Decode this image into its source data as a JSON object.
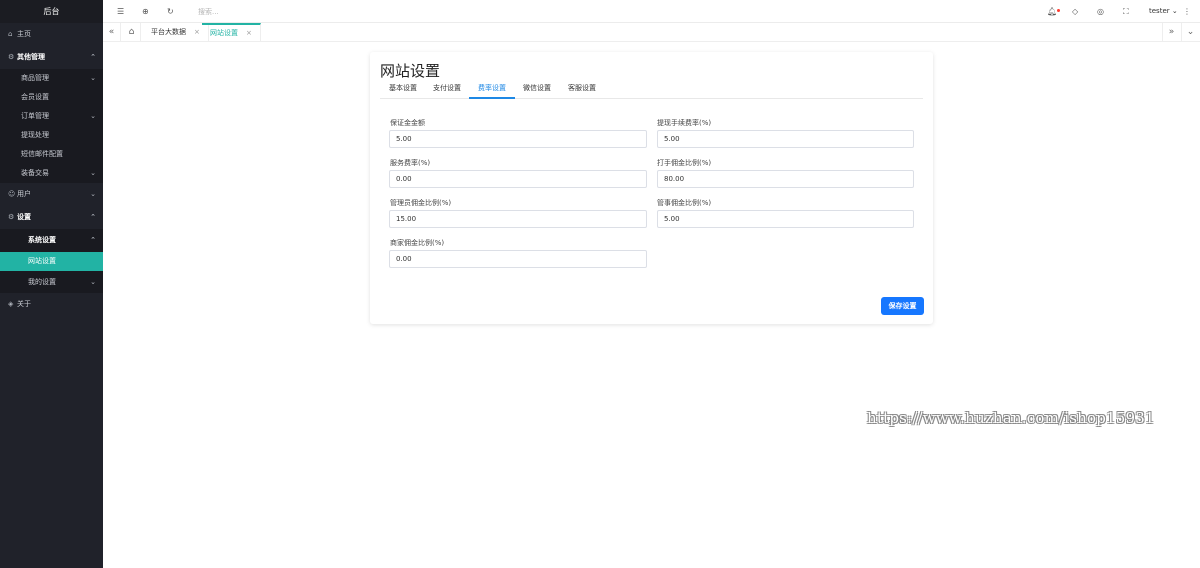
{
  "sidebar": {
    "brand": "后台",
    "home": {
      "label": "主页",
      "icon": "home-icon"
    },
    "other_mgmt": {
      "label": "其他管理",
      "icon": "gear-icon"
    },
    "other_items": [
      {
        "label": "商品管理",
        "has_children": true
      },
      {
        "label": "会员设置",
        "has_children": false
      },
      {
        "label": "订单管理",
        "has_children": true
      },
      {
        "label": "提现处理",
        "has_children": false
      },
      {
        "label": "短信邮件配置",
        "has_children": false
      },
      {
        "label": "装备交易",
        "has_children": true
      }
    ],
    "users": {
      "label": "用户",
      "icon": "user-icon"
    },
    "settings": {
      "label": "设置",
      "icon": "gear-icon"
    },
    "system_settings": "系统设置",
    "website_settings": "网站设置",
    "my_settings": "我的设置",
    "about": {
      "label": "关于",
      "icon": "shield-icon"
    }
  },
  "topbar": {
    "search_placeholder": "搜索...",
    "user": "tester"
  },
  "tabs": {
    "items": [
      {
        "label": "平台大数据"
      },
      {
        "label": "网站设置",
        "active": true
      }
    ]
  },
  "card": {
    "title": "网站设置",
    "tabs": [
      "基本设置",
      "支付设置",
      "费率设置",
      "微信设置",
      "客服设置"
    ],
    "active_tab_index": 2,
    "fields": [
      {
        "label": "保证金金额",
        "value": "5.00"
      },
      {
        "label": "提现手续费率(%)",
        "value": "5.00"
      },
      {
        "label": "服务费率(%)",
        "value": "0.00"
      },
      {
        "label": "打手佣金比例(%)",
        "value": "80.00"
      },
      {
        "label": "管理员佣金比例(%)",
        "value": "15.00"
      },
      {
        "label": "管事佣金比例(%)",
        "value": "5.00"
      },
      {
        "label": "商家佣金比例(%)",
        "value": "0.00"
      }
    ],
    "save_label": "保存设置"
  },
  "watermark": "https://www.huzhan.com/ishop15931",
  "colors": {
    "sidebar_bg": "#20222a",
    "accent_teal": "#22b3a4",
    "primary_blue": "#1677ff"
  }
}
